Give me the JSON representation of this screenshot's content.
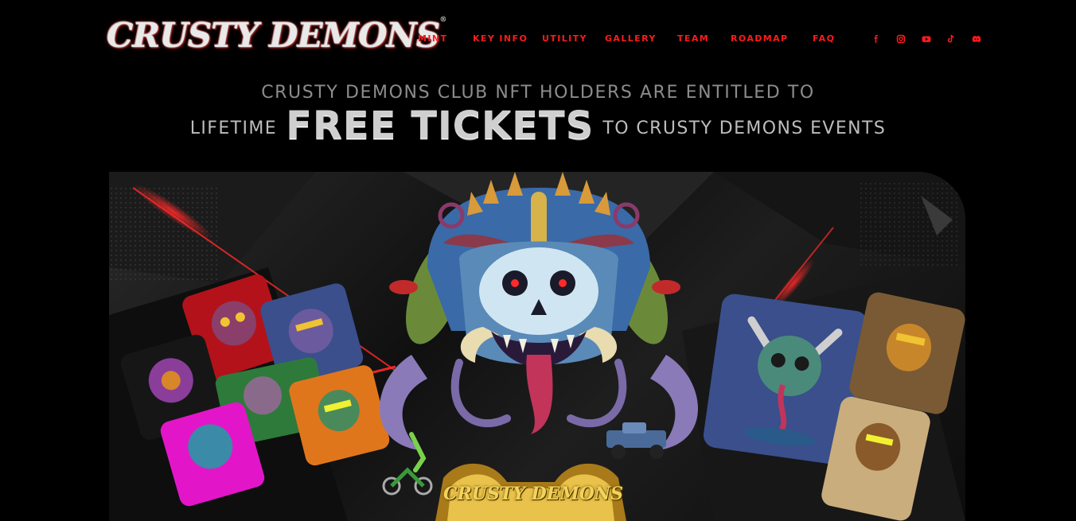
{
  "header": {
    "logo_text": "CRUSTY DEMONS",
    "nav": [
      "MINT",
      "KEY INFO",
      "UTILITY",
      "GALLERY",
      "TEAM",
      "ROADMAP",
      "FAQ"
    ],
    "socials": [
      "facebook-icon",
      "instagram-icon",
      "youtube-icon",
      "tiktok-icon",
      "discord-icon"
    ]
  },
  "headline": {
    "line1": "CRUSTY DEMONS CLUB NFT HOLDERS ARE ENTITLED TO",
    "line2_prefix": "LIFETIME",
    "line2_emphasis": "FREE TICKETS",
    "line2_suffix": "TO CRUSTY DEMONS EVENTS"
  },
  "hero": {
    "brand_text": "CRUSTY DEMONS",
    "colors": {
      "accent_red": "#ff1a1a",
      "card_red": "#b3121a",
      "card_blue": "#3a4f8c",
      "card_orange": "#e0761c",
      "card_magenta": "#e216c8",
      "card_black": "#161616",
      "card_brown": "#7a5a34",
      "card_tan": "#c9ad7c"
    }
  }
}
